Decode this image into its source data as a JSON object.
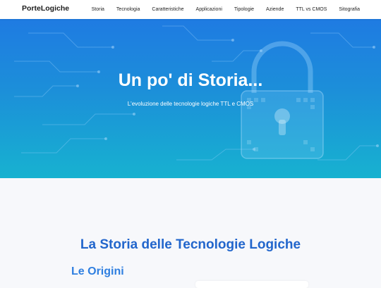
{
  "brand": "PorteLogiche",
  "nav": [
    {
      "label": "Storia"
    },
    {
      "label": "Tecnologia"
    },
    {
      "label": "Caratteristiche"
    },
    {
      "label": "Applicazioni"
    },
    {
      "label": "Tipologie"
    },
    {
      "label": "Aziende"
    },
    {
      "label": "TTL vs CMOS"
    },
    {
      "label": "Sitografia"
    }
  ],
  "hero": {
    "title": "Un po' di Storia...",
    "subtitle": "L'evoluzione delle tecnologie logiche TTL e CMOS",
    "background_image": "padlock-circuit-icon"
  },
  "content": {
    "section_title": "La Storia delle Tecnologie Logiche",
    "subsection_title": "Le Origini"
  },
  "colors": {
    "hero_top": "#1f7be2",
    "hero_bottom": "#17b2d0",
    "heading_blue": "#2266cc",
    "subheading_blue": "#2f7fe0"
  }
}
